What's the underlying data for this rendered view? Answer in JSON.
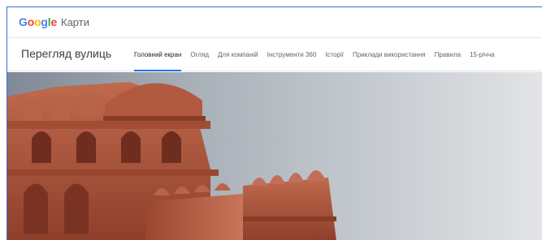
{
  "header": {
    "logo_text": [
      "G",
      "o",
      "o",
      "g",
      "l",
      "e"
    ],
    "product_name": "Карти"
  },
  "nav": {
    "title": "Перегляд вулиць",
    "tabs": [
      {
        "label": "Головний екран",
        "active": true
      },
      {
        "label": "Огляд",
        "active": false
      },
      {
        "label": "Для компаній",
        "active": false
      },
      {
        "label": "Інструменти 360",
        "active": false
      },
      {
        "label": "Історії",
        "active": false
      },
      {
        "label": "Приклади використання",
        "active": false
      },
      {
        "label": "Правила",
        "active": false
      },
      {
        "label": "15-річча",
        "active": false
      }
    ]
  },
  "colors": {
    "accent": "#1a73e8",
    "google_blue": "#4285F4",
    "google_red": "#EA4335",
    "google_yellow": "#FBBC05",
    "google_green": "#34A853",
    "fort_sandstone": "#b5573e"
  }
}
